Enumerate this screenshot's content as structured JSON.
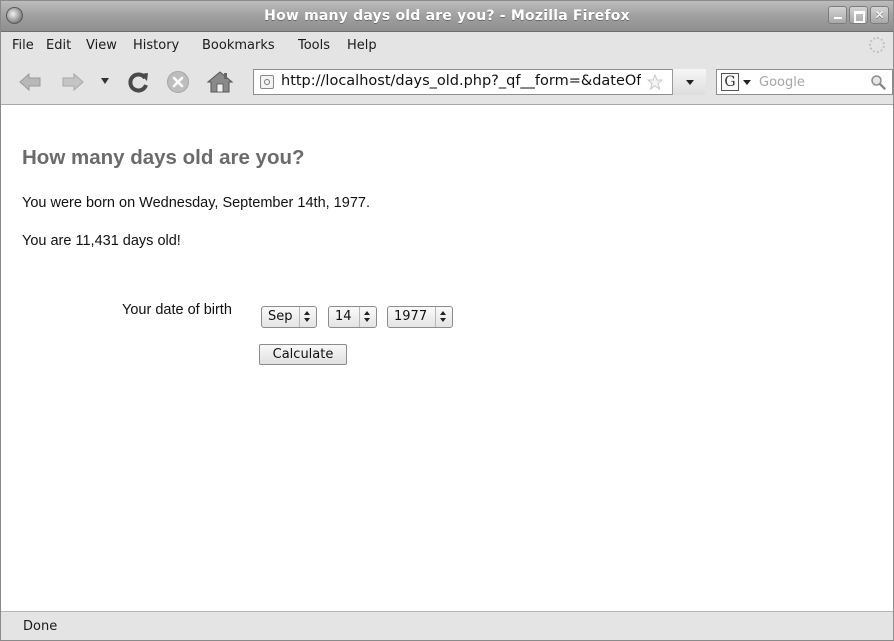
{
  "window": {
    "title": "How many days old are you? - Mozilla Firefox"
  },
  "menu": {
    "items": [
      "File",
      "Edit",
      "View",
      "History",
      "Bookmarks",
      "Tools",
      "Help"
    ]
  },
  "toolbar": {
    "url": "http://localhost/days_old.php?_qf__form=&dateOf",
    "search_placeholder": "Google",
    "search_engine_label": "G",
    "icons": [
      "back-icon",
      "forward-icon",
      "history-dropdown-icon",
      "reload-icon",
      "stop-icon",
      "home-icon",
      "site-icon",
      "bookmark-star-icon",
      "magnifier-icon"
    ]
  },
  "page": {
    "heading": "How many days old are you?",
    "born_line": "You were born on Wednesday, September 14th, 1977.",
    "days_line": "You are 11,431 days old!",
    "dob_label": "Your date of birth",
    "month_value": "Sep",
    "day_value": "14",
    "year_value": "1977",
    "calculate_label": "Calculate"
  },
  "status": {
    "text": "Done"
  },
  "colors": {
    "heading": "#6b6b6b",
    "titlebar_text": "#ffffff",
    "content_background": "#ffffff",
    "chrome_background": "#e4e4e4"
  }
}
